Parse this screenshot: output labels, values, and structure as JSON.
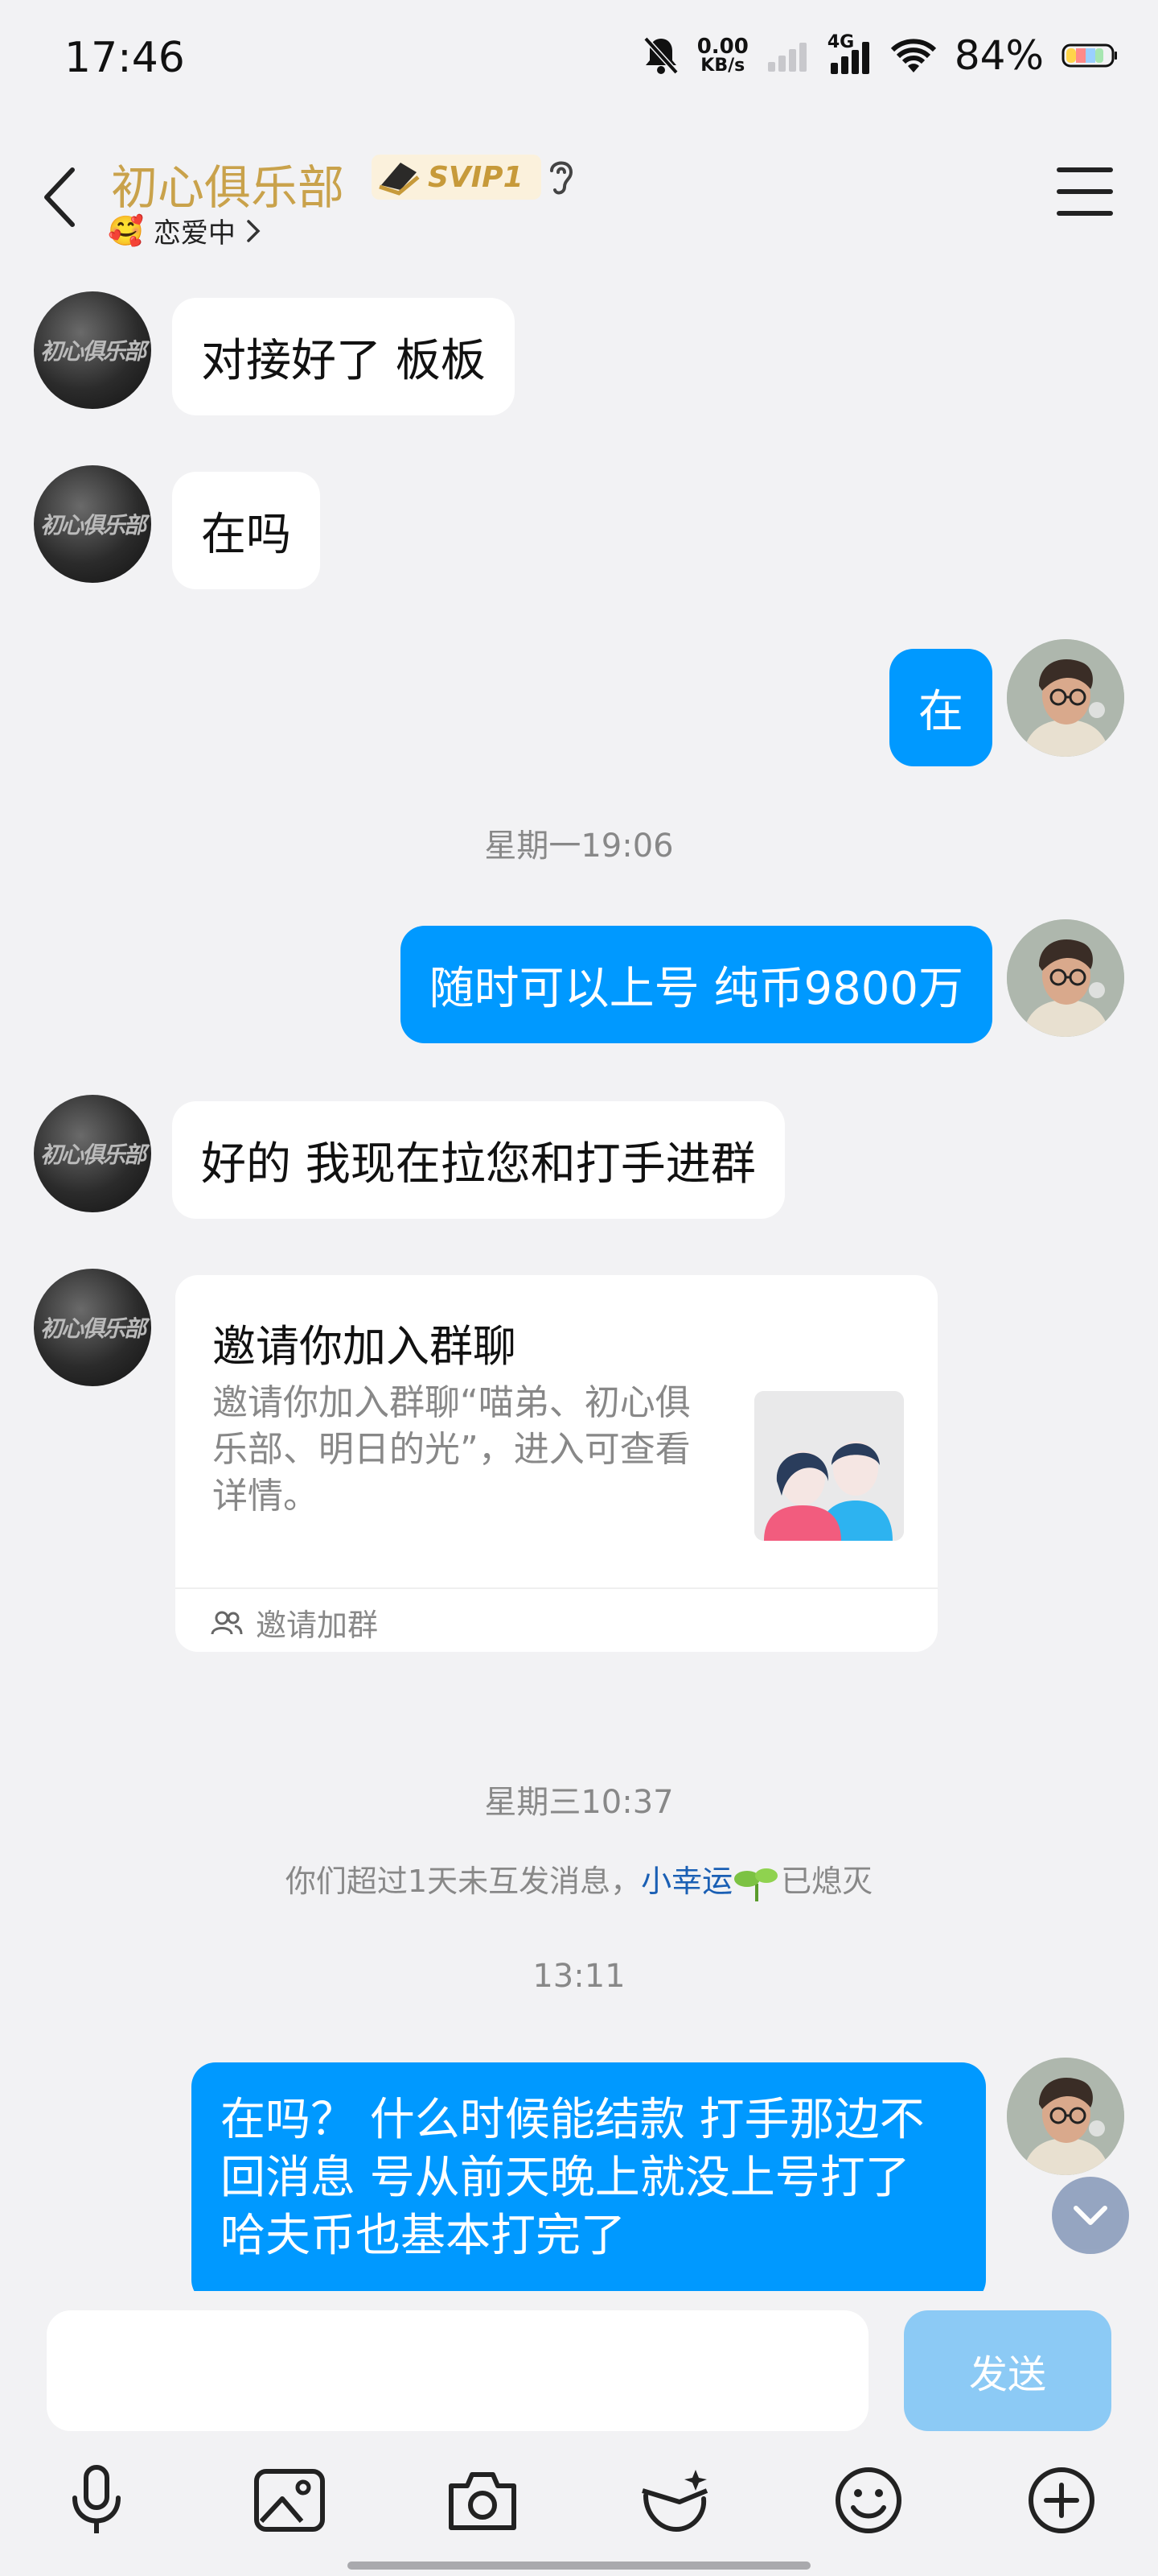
{
  "status_bar": {
    "time": "17:46",
    "net_speed_value": "0.00",
    "net_speed_unit": "KB/s",
    "network_type": "4G",
    "battery": "84%"
  },
  "header": {
    "title": "初心俱乐部",
    "badge": "SVIP1",
    "status_emoji": "🥰",
    "status_text": "恋爱中"
  },
  "messages": {
    "m1": "对接好了 板板",
    "m2": "在吗",
    "m3": "在",
    "ts1": "星期一19:06",
    "m4": "随时可以上号 纯币9800万",
    "m5": "好的 我现在拉您和打手进群",
    "invite_title": "邀请你加入群聊",
    "invite_desc": "邀请你加入群聊“喵弟、初心俱乐部、明日的光”，进入可查看详情。",
    "invite_footer": "邀请加群",
    "ts2": "星期三10:37",
    "notice_prefix": "你们超过1天未互发消息，",
    "notice_link": "小幸运",
    "notice_suffix": "已熄灭",
    "ts3": "13:11",
    "m6": "在吗？ 什么时候能结款  打手那边不回消息 号从前天晚上就没上号打了  哈夫币也基本打完了"
  },
  "avatar_logo": "初心俱乐部",
  "input": {
    "value": "",
    "send_label": "发送"
  },
  "colors": {
    "accent_blue": "#0099ff",
    "title_gold": "#c9a24b",
    "send_disabled": "#8ccaf5"
  }
}
